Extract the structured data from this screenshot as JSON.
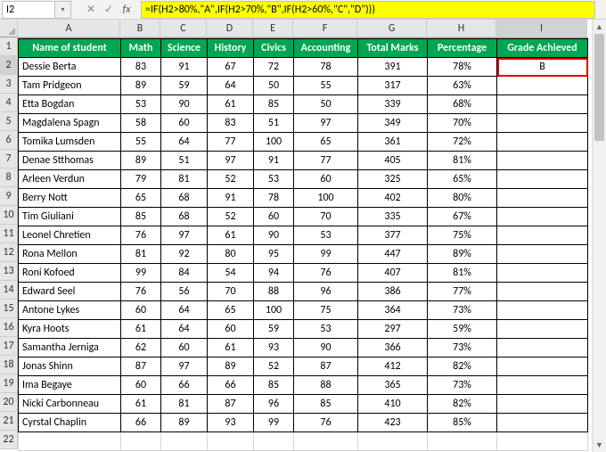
{
  "nameBox": "I2",
  "formula": "=IF(H2>80%,\"A\",IF(H2>70%,\"B\",IF(H2>60%,\"C\",\"D\")))",
  "colWidths": {
    "rowHdr": 20,
    "A": 115,
    "B": 45,
    "C": 52,
    "D": 52,
    "E": 45,
    "F": 72,
    "G": 78,
    "H": 78,
    "I": 102
  },
  "columns": [
    "A",
    "B",
    "C",
    "D",
    "E",
    "F",
    "G",
    "H",
    "I"
  ],
  "activeCol": "I",
  "activeRow": 2,
  "headers": [
    "Name of student",
    "Math",
    "Science",
    "History",
    "Civics",
    "Accounting",
    "Total Marks",
    "Percentage",
    "Grade Achieved"
  ],
  "rows": [
    {
      "name": "Dessie Berta",
      "math": 83,
      "science": 91,
      "history": 67,
      "civics": 72,
      "accounting": 78,
      "total": 391,
      "pct": "78%",
      "grade": "B"
    },
    {
      "name": "Tam Pridgeon",
      "math": 89,
      "science": 59,
      "history": 64,
      "civics": 50,
      "accounting": 55,
      "total": 317,
      "pct": "63%",
      "grade": ""
    },
    {
      "name": "Etta Bogdan",
      "math": 53,
      "science": 90,
      "history": 61,
      "civics": 85,
      "accounting": 50,
      "total": 339,
      "pct": "68%",
      "grade": ""
    },
    {
      "name": "Magdalena Spagn",
      "math": 58,
      "science": 60,
      "history": 83,
      "civics": 51,
      "accounting": 97,
      "total": 349,
      "pct": "70%",
      "grade": ""
    },
    {
      "name": "Tomika Lumsden",
      "math": 55,
      "science": 64,
      "history": 77,
      "civics": 100,
      "accounting": 65,
      "total": 361,
      "pct": "72%",
      "grade": ""
    },
    {
      "name": "Denae Stthomas",
      "math": 89,
      "science": 51,
      "history": 97,
      "civics": 91,
      "accounting": 77,
      "total": 405,
      "pct": "81%",
      "grade": ""
    },
    {
      "name": "Arleen Verdun",
      "math": 79,
      "science": 81,
      "history": 52,
      "civics": 53,
      "accounting": 60,
      "total": 325,
      "pct": "65%",
      "grade": ""
    },
    {
      "name": "Berry Nott",
      "math": 65,
      "science": 68,
      "history": 91,
      "civics": 78,
      "accounting": 100,
      "total": 402,
      "pct": "80%",
      "grade": ""
    },
    {
      "name": "Tim Giuliani",
      "math": 85,
      "science": 68,
      "history": 52,
      "civics": 60,
      "accounting": 70,
      "total": 335,
      "pct": "67%",
      "grade": ""
    },
    {
      "name": "Leonel Chretien",
      "math": 76,
      "science": 97,
      "history": 61,
      "civics": 90,
      "accounting": 53,
      "total": 377,
      "pct": "75%",
      "grade": ""
    },
    {
      "name": "Rona Mellon",
      "math": 81,
      "science": 92,
      "history": 80,
      "civics": 95,
      "accounting": 99,
      "total": 447,
      "pct": "89%",
      "grade": ""
    },
    {
      "name": "Roni Kofoed",
      "math": 99,
      "science": 84,
      "history": 54,
      "civics": 94,
      "accounting": 76,
      "total": 407,
      "pct": "81%",
      "grade": ""
    },
    {
      "name": "Edward Seel",
      "math": 76,
      "science": 56,
      "history": 70,
      "civics": 88,
      "accounting": 96,
      "total": 386,
      "pct": "77%",
      "grade": ""
    },
    {
      "name": "Antone Lykes",
      "math": 60,
      "science": 64,
      "history": 65,
      "civics": 100,
      "accounting": 75,
      "total": 364,
      "pct": "73%",
      "grade": ""
    },
    {
      "name": "Kyra Hoots",
      "math": 61,
      "science": 64,
      "history": 60,
      "civics": 59,
      "accounting": 53,
      "total": 297,
      "pct": "59%",
      "grade": ""
    },
    {
      "name": "Samantha Jerniga",
      "math": 62,
      "science": 60,
      "history": 61,
      "civics": 93,
      "accounting": 90,
      "total": 366,
      "pct": "73%",
      "grade": ""
    },
    {
      "name": "Jonas Shinn",
      "math": 87,
      "science": 97,
      "history": 89,
      "civics": 52,
      "accounting": 87,
      "total": 412,
      "pct": "82%",
      "grade": ""
    },
    {
      "name": "Ima Begaye",
      "math": 60,
      "science": 66,
      "history": 66,
      "civics": 85,
      "accounting": 88,
      "total": 365,
      "pct": "73%",
      "grade": ""
    },
    {
      "name": "Nicki Carbonneau",
      "math": 61,
      "science": 81,
      "history": 87,
      "civics": 96,
      "accounting": 85,
      "total": 410,
      "pct": "82%",
      "grade": ""
    },
    {
      "name": "Cyrstal Chaplin",
      "math": 66,
      "science": 89,
      "history": 93,
      "civics": 99,
      "accounting": 76,
      "total": 423,
      "pct": "85%",
      "grade": ""
    }
  ],
  "icons": {
    "cancel": "✕",
    "confirm": "✓",
    "dropdown": "▾",
    "up": "▲",
    "down": "▼"
  },
  "fxLabel": "fx",
  "chart_data": {
    "type": "table",
    "title": "Student Grades",
    "columns": [
      "Name of student",
      "Math",
      "Science",
      "History",
      "Civics",
      "Accounting",
      "Total Marks",
      "Percentage",
      "Grade Achieved"
    ],
    "active_formula": "=IF(H2>80%,\"A\",IF(H2>70%,\"B\",IF(H2>60%,\"C\",\"D\")))"
  }
}
